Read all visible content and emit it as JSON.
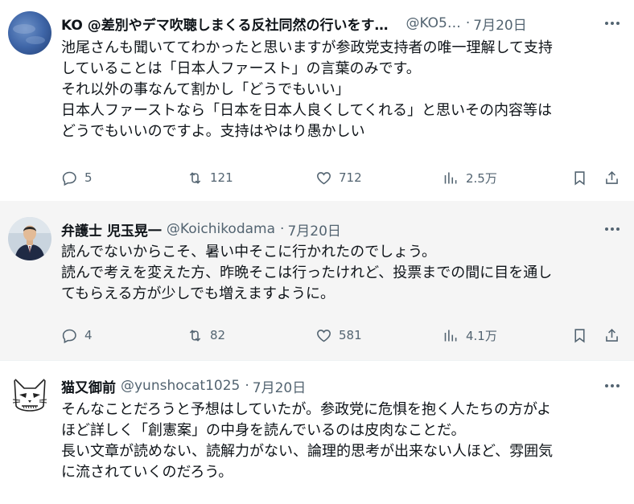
{
  "tweets": [
    {
      "avatar": "blue-sky-avatar",
      "name": "KO @差別やデマ吹聴しまくる反社同然の行いをす…",
      "handle": "@KO5…",
      "date": "7月20日",
      "lines": [
        "池尾さんも聞いててわかったと思いますが参政党支持者の唯一理解して支持",
        "していることは「日本人ファースト」の言葉のみです。",
        "それ以外の事なんて割かし「どうでもいい」",
        "日本人ファーストなら「日本を日本人良くしてくれる」と思いその内容等は",
        "どうでもいいのですよ。支持はやはり愚かしい"
      ],
      "replies": "5",
      "retweets": "121",
      "likes": "712",
      "views": "2.5万"
    },
    {
      "avatar": "suited-man-avatar",
      "name": "弁護士 児玉晃一",
      "handle": "@Koichikodama",
      "date": "7月20日",
      "lines": [
        "読んでないからこそ、暑い中そこに行かれたのでしょう。",
        "読んで考えを変えた方、昨晩そこは行ったけれど、投票までの間に目を通し",
        "てもらえる方が少しでも増えますように。"
      ],
      "replies": "4",
      "retweets": "82",
      "likes": "581",
      "views": "4.1万"
    },
    {
      "avatar": "cat-sketch-avatar",
      "name": "猫又御前",
      "handle": "@yunshocat1025",
      "date": "7月20日",
      "lines": [
        "そんなことだろうと予想はしていたが。参政党に危惧を抱く人たちの方がよ",
        "ほど詳しく「創憲案」の中身を読んでいるのは皮肉なことだ。",
        "長い文章が読めない、読解力がない、論理的思考が出来ない人ほど、雰囲気",
        "に流されていくのだろう。"
      ]
    }
  ],
  "separator": "·",
  "colors": {
    "muted": "#536471",
    "highlight_bg": "#f5f5f5",
    "text": "#0f1419"
  }
}
